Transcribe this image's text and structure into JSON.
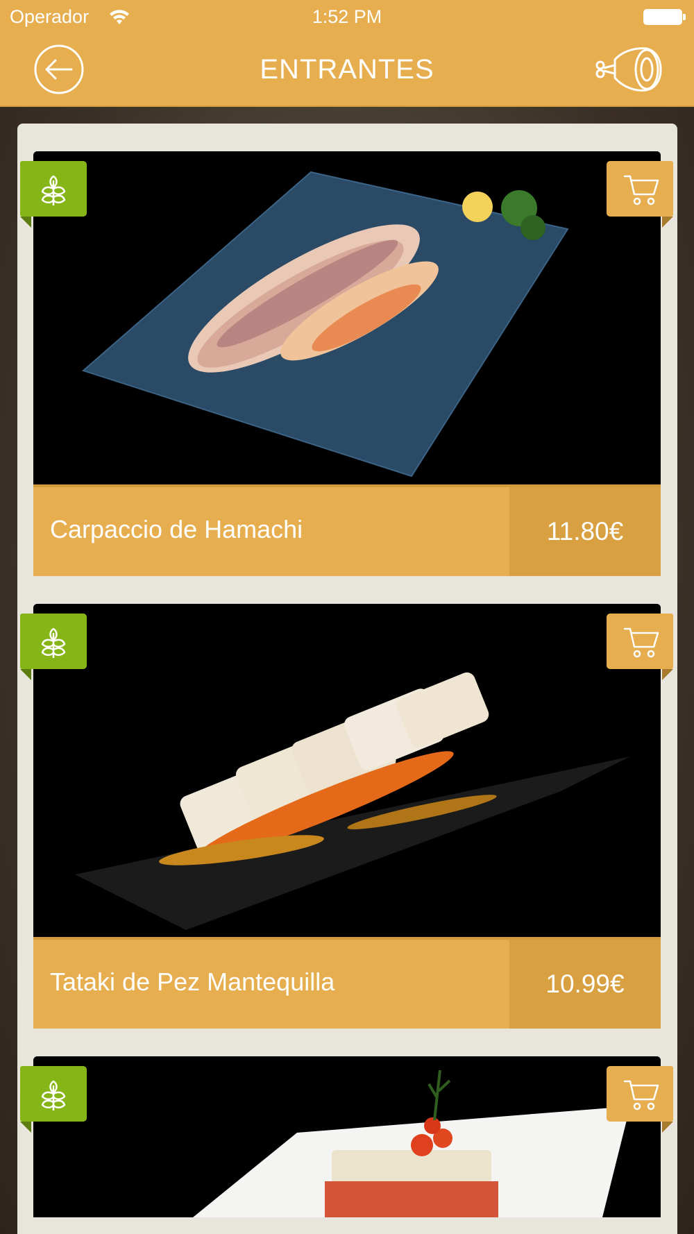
{
  "status_bar": {
    "carrier": "Operador",
    "time": "1:52 PM"
  },
  "header": {
    "title": "ENTRANTES",
    "back_icon": "back-arrow-circle-icon",
    "category_icon": "ham-leg-icon"
  },
  "colors": {
    "header_bg": "#e6ae4f",
    "price_bg": "#d9a041",
    "veg_badge": "#86b518",
    "panel_bg": "#e8e5dd"
  },
  "dishes": [
    {
      "name": "Carpaccio de Hamachi",
      "price": "11.80€",
      "badge_icon": "wheat-icon",
      "action_icon": "cart-icon"
    },
    {
      "name": "Tataki de Pez Mantequilla",
      "price": "10.99€",
      "badge_icon": "wheat-icon",
      "action_icon": "cart-icon"
    },
    {
      "name": "",
      "price": "",
      "badge_icon": "wheat-icon",
      "action_icon": "cart-icon"
    }
  ]
}
